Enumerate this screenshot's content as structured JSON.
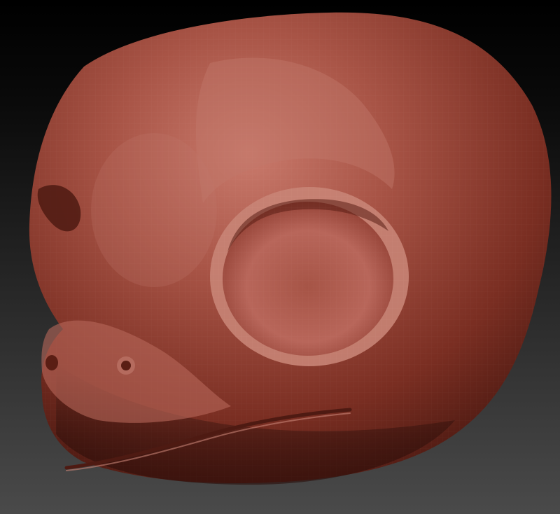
{
  "viewport": {
    "subject": "sculpt-model-head",
    "material_color": "#a0463a",
    "highlight_color": "#c97a6c",
    "shadow_color": "#4e1a12",
    "background_top": "#000000",
    "background_bottom": "#4a4a4a"
  }
}
